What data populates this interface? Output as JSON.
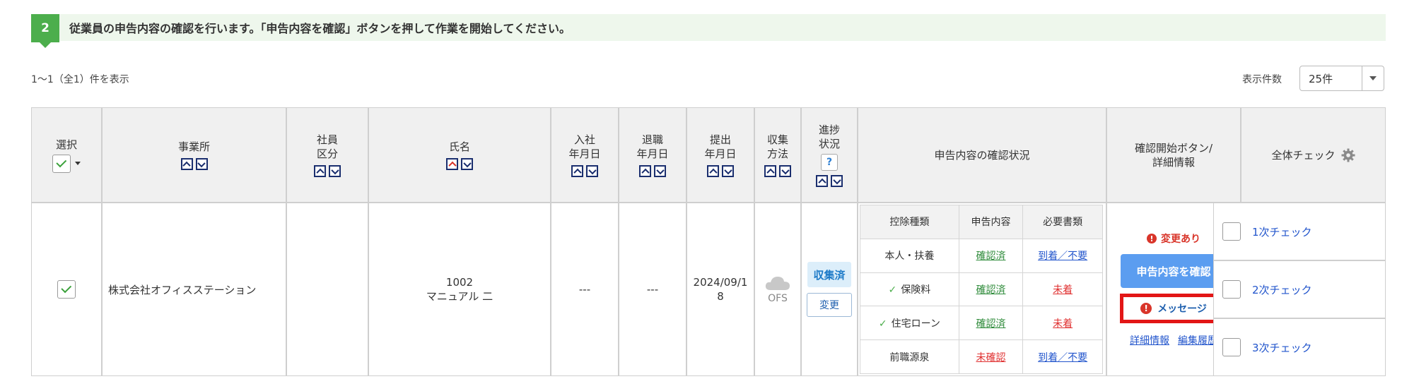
{
  "step": {
    "number": "2",
    "message": "従業員の申告内容の確認を行います。「申告内容を確認」ボタンを押して作業を開始してください。"
  },
  "count_label": "1〜1（全1）件を表示",
  "per_page": {
    "label": "表示件数",
    "value": "25件"
  },
  "headers": {
    "select": "選択",
    "office": "事業所",
    "emp_type_1": "社員",
    "emp_type_2": "区分",
    "name": "氏名",
    "join_1": "入社",
    "join_2": "年月日",
    "retire_1": "退職",
    "retire_2": "年月日",
    "submit_1": "提出",
    "submit_2": "年月日",
    "method_1": "収集",
    "method_2": "方法",
    "progress_1": "進捗",
    "progress_2": "状況",
    "help": "?",
    "confirm_status": "申告内容の確認状況",
    "start_1": "確認開始ボタン/",
    "start_2": "詳細情報",
    "all_check": "全体チェック"
  },
  "row": {
    "office": "株式会社オフィスステーション",
    "emp_no": "1002",
    "name": "マニュアル 二",
    "join_date": "---",
    "retire_date": "---",
    "submit_date_1": "2024/09/1",
    "submit_date_2": "8",
    "method": "OFS",
    "status_badge": "収集済",
    "change_button": "変更"
  },
  "confirm_table": {
    "headers": [
      "控除種類",
      "申告内容",
      "必要書類"
    ],
    "rows": [
      {
        "type": "本人・扶養",
        "checked": false,
        "content": "確認済",
        "content_color": "green",
        "docs": "到着／不要",
        "docs_color": "blue"
      },
      {
        "type": "保険料",
        "checked": true,
        "content": "確認済",
        "content_color": "green",
        "docs": "未着",
        "docs_color": "red"
      },
      {
        "type": "住宅ローン",
        "checked": true,
        "content": "確認済",
        "content_color": "green",
        "docs": "未着",
        "docs_color": "red"
      },
      {
        "type": "前職源泉",
        "checked": false,
        "content": "未確認",
        "content_color": "red",
        "docs": "到着／不要",
        "docs_color": "blue"
      }
    ]
  },
  "actions": {
    "changed_label": "変更あり",
    "confirm_button": "申告内容を確認",
    "message_button": "メッセージ",
    "detail_link": "詳細情報",
    "history_link": "編集履歴"
  },
  "checks": [
    "1次チェック",
    "2次チェック",
    "3次チェック"
  ]
}
